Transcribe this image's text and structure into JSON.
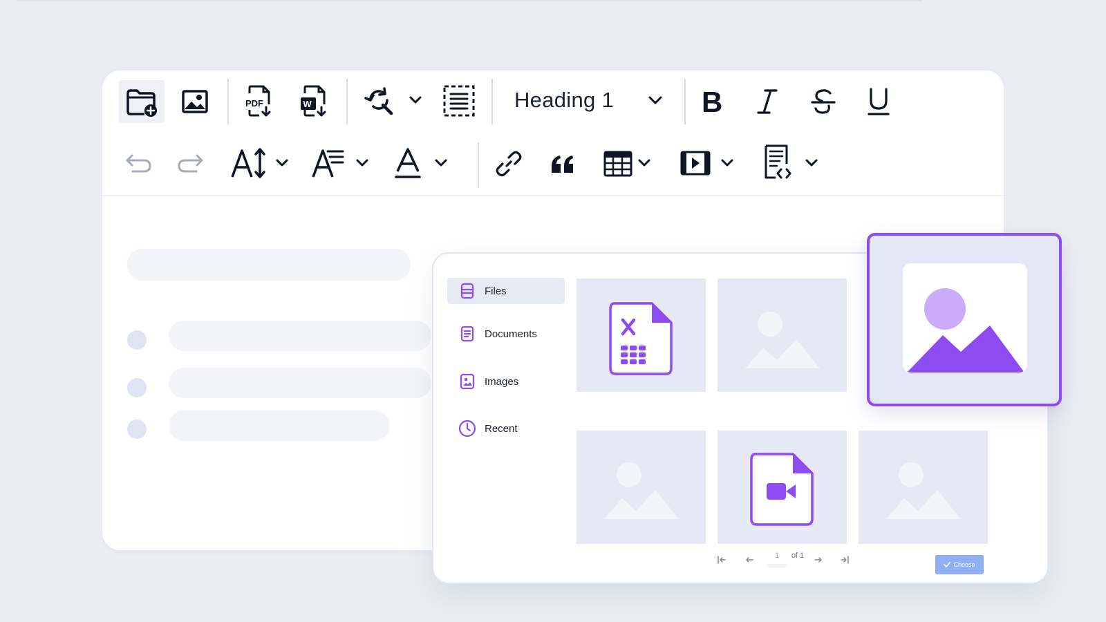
{
  "toolbar": {
    "heading_select": "Heading 1"
  },
  "file_manager": {
    "sidebar": [
      {
        "label": "Files",
        "icon": "files-icon",
        "active": true
      },
      {
        "label": "Documents",
        "icon": "document-icon",
        "active": false
      },
      {
        "label": "Images",
        "icon": "image-icon",
        "active": false
      },
      {
        "label": "Recent",
        "icon": "clock-icon",
        "active": false
      }
    ],
    "tiles": [
      {
        "type": "excel-file"
      },
      {
        "type": "image"
      },
      {
        "type": "image-selected"
      },
      {
        "type": "image"
      },
      {
        "type": "video-file"
      },
      {
        "type": "image"
      }
    ],
    "pagination": {
      "current_page": "1",
      "of_label": "of 1"
    },
    "choose_label": "Choose"
  },
  "colors": {
    "accent": "#8d4cf2",
    "tile_bg": "#e6e8f4",
    "choose_button": "#8fb1f3"
  }
}
